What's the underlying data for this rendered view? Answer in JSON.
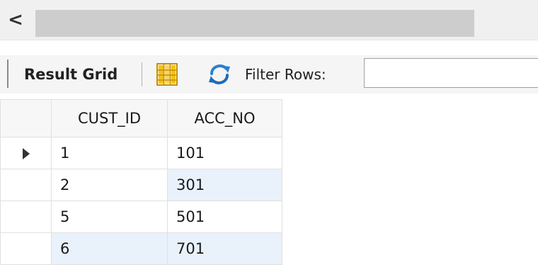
{
  "scrollbar": {
    "left_arrow_glyph": "<"
  },
  "toolbar": {
    "tab_label": "Result Grid",
    "filter_label": "Filter Rows:",
    "filter_value": "",
    "grid_icon": "form-grid-icon",
    "refresh_icon": "refresh-icon"
  },
  "grid": {
    "columns": [
      "CUST_ID",
      "ACC_NO"
    ],
    "rows": [
      {
        "cust_id": "1",
        "acc_no": "101",
        "current": true
      },
      {
        "cust_id": "2",
        "acc_no": "301",
        "current": false
      },
      {
        "cust_id": "5",
        "acc_no": "501",
        "current": false
      },
      {
        "cust_id": "6",
        "acc_no": "701",
        "current": false
      }
    ]
  },
  "colors": {
    "zebra_highlight": "#e9f1fb",
    "refresh_blue": "#2a7fd4",
    "grid_icon_yellow": "#f2c21b"
  }
}
